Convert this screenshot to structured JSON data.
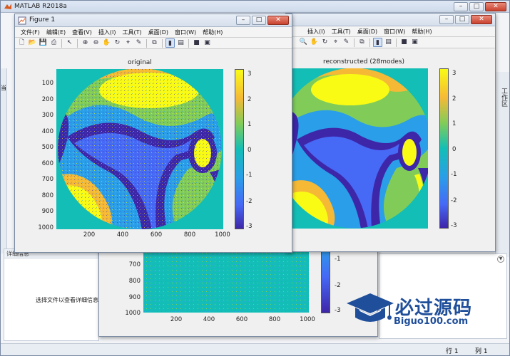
{
  "matlab": {
    "title": "MATLAB R2018a",
    "detail_header": "详细信息",
    "detail_message": "选择文件以查看详细信息",
    "right_sidebar_label": "工作区",
    "left_sidebar_label": "当",
    "status": {
      "row_label": "行",
      "row_value": "1",
      "col_label": "列",
      "col_value": "1"
    }
  },
  "figure1": {
    "title": "Figure 1",
    "menu": [
      "文件(F)",
      "编辑(E)",
      "查看(V)",
      "插入(I)",
      "工具(T)",
      "桌面(D)",
      "窗口(W)",
      "帮助(H)"
    ],
    "plot_title": "original",
    "y_ticks": [
      "100",
      "200",
      "300",
      "400",
      "500",
      "600",
      "700",
      "800",
      "900",
      "1000"
    ],
    "x_ticks": [
      "200",
      "400",
      "600",
      "800",
      "1000"
    ],
    "colorbar_ticks": [
      "3",
      "2",
      "1",
      "0",
      "-1",
      "-2",
      "-3"
    ]
  },
  "figure2": {
    "menu": [
      "插入(I)",
      "工具(T)",
      "桌面(D)",
      "窗口(W)",
      "帮助(H)"
    ],
    "plot_title": "reconstructed (28modes)",
    "colorbar_ticks": [
      "3",
      "2",
      "1",
      "0",
      "-1",
      "-2",
      "-3"
    ]
  },
  "figure3": {
    "y_ticks": [
      "700",
      "800",
      "900",
      "1000"
    ],
    "x_ticks": [
      "200",
      "400",
      "600",
      "800",
      "1000"
    ],
    "colorbar_ticks": [
      "-1",
      "-2",
      "-3"
    ]
  },
  "watermark": {
    "title": "必过源码",
    "url": "Biguo100.com"
  },
  "colors": {
    "accent": "#1f4e9a",
    "teal_bg": "#13beb6",
    "yellow": "#f9fb15",
    "blue": "#3e26a8"
  }
}
